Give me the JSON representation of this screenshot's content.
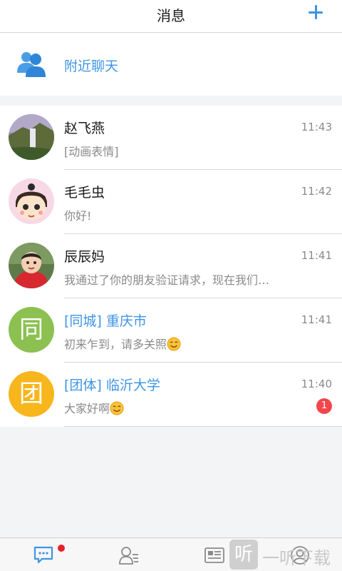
{
  "header": {
    "title": "消息"
  },
  "nearby": {
    "label": "附近聊天"
  },
  "conversations": [
    {
      "name": "赵飞燕",
      "time": "11:43",
      "message": "[动画表情]"
    },
    {
      "name": "毛毛虫",
      "time": "11:42",
      "message": "你好!"
    },
    {
      "name": "辰辰妈",
      "time": "11:41",
      "message": "我通过了你的朋友验证请求，现在我们…"
    },
    {
      "name": "[同城] 重庆市",
      "time": "11:41",
      "message": "初来乍到，请多关照",
      "avatar_char": "同",
      "avatar_color": "#8cc152"
    },
    {
      "name": "[团体] 临沂大学",
      "time": "11:40",
      "message": "大家好啊",
      "avatar_char": "团",
      "avatar_color": "#f6b61c",
      "unread": "1"
    }
  ],
  "watermark": {
    "icon_char": "听",
    "text": "一听下载"
  },
  "colors": {
    "accent": "#3f95e3",
    "badge": "#f0474b",
    "notify_dot": "#e8202a"
  }
}
